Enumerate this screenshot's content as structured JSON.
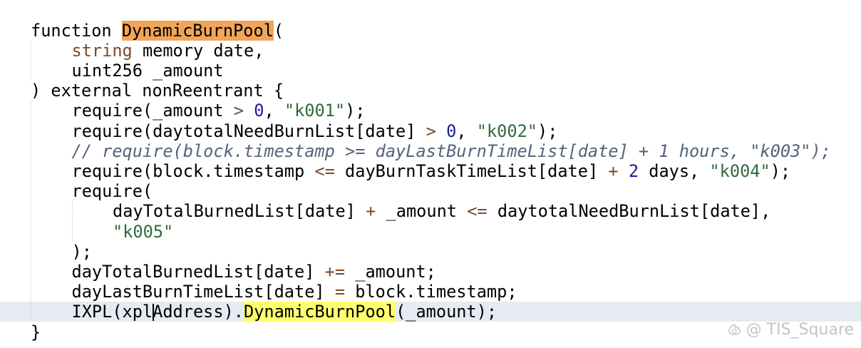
{
  "editor": {
    "current_line_index": 14,
    "lines": [
      {
        "indent": 0,
        "tokens": [
          {
            "text": "function ",
            "kind": "plain"
          },
          {
            "text": "DynamicBurnPool",
            "kind": "plain",
            "highlight": "orange"
          },
          {
            "text": "(",
            "kind": "plain"
          }
        ]
      },
      {
        "indent": 1,
        "tokens": [
          {
            "text": "string",
            "kind": "type"
          },
          {
            "text": " memory date,",
            "kind": "plain"
          }
        ]
      },
      {
        "indent": 1,
        "tokens": [
          {
            "text": "uint256 _amount",
            "kind": "plain"
          }
        ]
      },
      {
        "indent": 0,
        "tokens": [
          {
            "text": ") external nonReentrant {",
            "kind": "plain"
          }
        ]
      },
      {
        "indent": 1,
        "tokens": [
          {
            "text": "require(_amount ",
            "kind": "plain"
          },
          {
            "text": ">",
            "kind": "op"
          },
          {
            "text": " ",
            "kind": "plain"
          },
          {
            "text": "0",
            "kind": "num"
          },
          {
            "text": ", ",
            "kind": "plain"
          },
          {
            "text": "\"k001\"",
            "kind": "str"
          },
          {
            "text": ");",
            "kind": "plain"
          }
        ]
      },
      {
        "indent": 1,
        "tokens": [
          {
            "text": "require(daytotalNeedBurnList[date] ",
            "kind": "plain"
          },
          {
            "text": ">",
            "kind": "op"
          },
          {
            "text": " ",
            "kind": "plain"
          },
          {
            "text": "0",
            "kind": "num"
          },
          {
            "text": ", ",
            "kind": "plain"
          },
          {
            "text": "\"k002\"",
            "kind": "str"
          },
          {
            "text": ");",
            "kind": "plain"
          }
        ]
      },
      {
        "indent": 1,
        "tokens": [
          {
            "text": "// require(block.timestamp >= dayLastBurnTimeList[date] + 1 hours, \"k003\");",
            "kind": "comment"
          }
        ]
      },
      {
        "indent": 1,
        "tokens": [
          {
            "text": "require(block.timestamp ",
            "kind": "plain"
          },
          {
            "text": "<=",
            "kind": "op"
          },
          {
            "text": " dayBurnTaskTimeList[date] ",
            "kind": "plain"
          },
          {
            "text": "+",
            "kind": "op"
          },
          {
            "text": " ",
            "kind": "plain"
          },
          {
            "text": "2",
            "kind": "num"
          },
          {
            "text": " days, ",
            "kind": "plain"
          },
          {
            "text": "\"k004\"",
            "kind": "str"
          },
          {
            "text": ");",
            "kind": "plain"
          }
        ]
      },
      {
        "indent": 1,
        "tokens": [
          {
            "text": "require(",
            "kind": "plain"
          }
        ]
      },
      {
        "indent": 2,
        "tokens": [
          {
            "text": "dayTotalBurnedList[date] ",
            "kind": "plain"
          },
          {
            "text": "+",
            "kind": "op"
          },
          {
            "text": " _amount ",
            "kind": "plain"
          },
          {
            "text": "<=",
            "kind": "op"
          },
          {
            "text": " daytotalNeedBurnList[date],",
            "kind": "plain"
          }
        ]
      },
      {
        "indent": 2,
        "tokens": [
          {
            "text": "\"k005\"",
            "kind": "str"
          }
        ]
      },
      {
        "indent": 1,
        "tokens": [
          {
            "text": ");",
            "kind": "plain"
          }
        ]
      },
      {
        "indent": 1,
        "tokens": [
          {
            "text": "dayTotalBurnedList[date] ",
            "kind": "plain"
          },
          {
            "text": "+=",
            "kind": "op"
          },
          {
            "text": " _amount;",
            "kind": "plain"
          }
        ]
      },
      {
        "indent": 1,
        "tokens": [
          {
            "text": "dayLastBurnTimeList[date] ",
            "kind": "plain"
          },
          {
            "text": "=",
            "kind": "op"
          },
          {
            "text": " block.timestamp;",
            "kind": "plain"
          }
        ]
      },
      {
        "indent": 1,
        "tokens": [
          {
            "text": "IXPL(xpl",
            "kind": "plain"
          },
          {
            "text": "Address).",
            "kind": "plain",
            "caret_before": true
          },
          {
            "text": "DynamicBurnPool",
            "kind": "plain",
            "highlight": "yellow"
          },
          {
            "text": "(_amount);",
            "kind": "plain"
          }
        ]
      },
      {
        "indent": 0,
        "tokens": [
          {
            "text": "}",
            "kind": "plain"
          }
        ]
      }
    ]
  },
  "watermark": {
    "icon": "weibo-logo-icon",
    "text": "@ TIS_Square"
  }
}
